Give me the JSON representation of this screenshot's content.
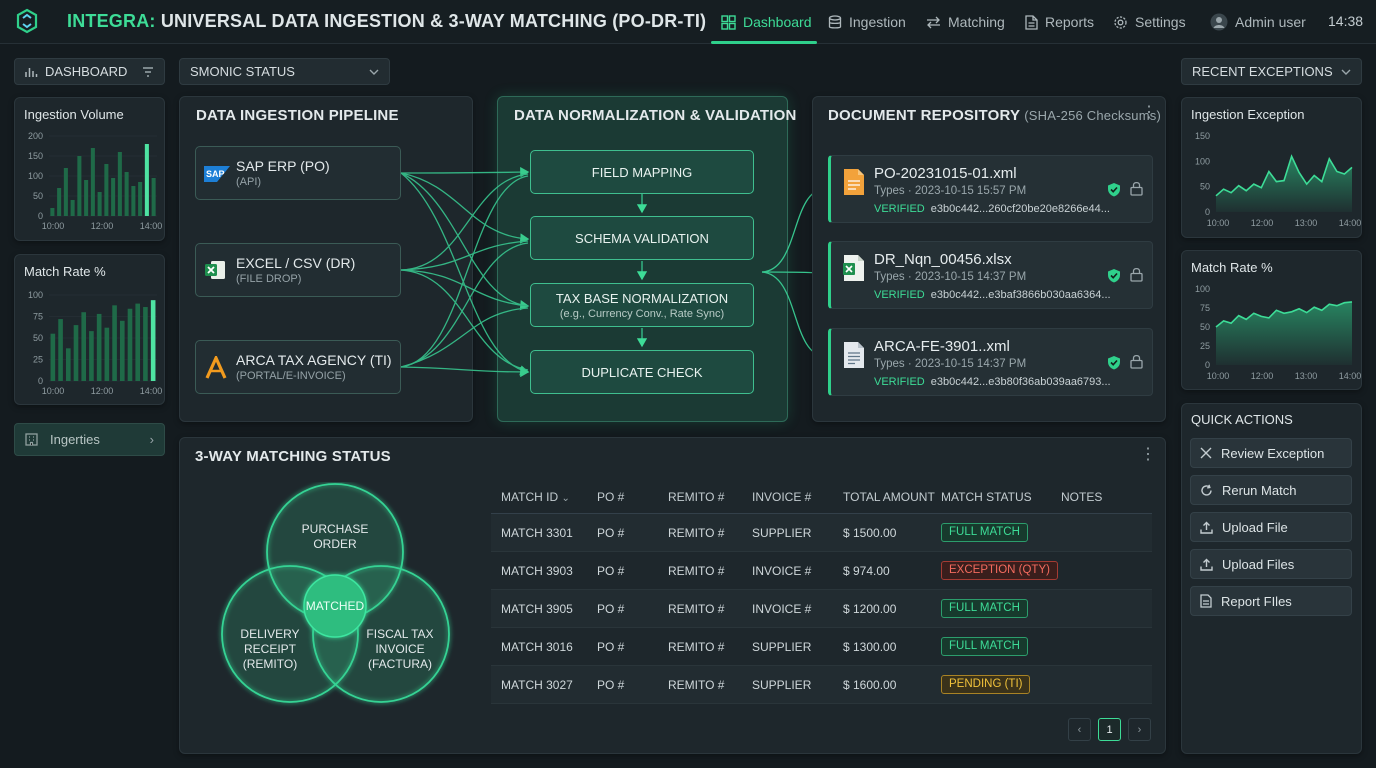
{
  "header": {
    "brand": "INTEGRA:",
    "title": "UNIVERSAL DATA INGESTION & 3-WAY MATCHING (PO-DR-TI)",
    "nav": [
      {
        "label": "Dashboard",
        "icon": "grid-icon",
        "active": true
      },
      {
        "label": "Ingestion",
        "icon": "database-icon"
      },
      {
        "label": "Matching",
        "icon": "swap-arrows-icon"
      },
      {
        "label": "Reports",
        "icon": "document-icon"
      },
      {
        "label": "Settings",
        "icon": "gear-icon"
      }
    ],
    "user": "Admin user",
    "clock": "14:38"
  },
  "sidebar": {
    "dashboard_label": "DASHBOARD",
    "status_select": "SMONIC STATUS",
    "nav_item": "Ingerties",
    "colors": {
      "accent": "#3ddc97",
      "bar": "#1f6a48"
    }
  },
  "left_charts": [
    {
      "title": "Ingestion Volume",
      "y_ticks": [
        "200",
        "150",
        "100",
        "50",
        "0"
      ],
      "x_ticks": [
        "10:00",
        "12:00",
        "14:00"
      ]
    },
    {
      "title": "Match Rate %",
      "y_ticks": [
        "100",
        "75",
        "50",
        "25",
        "0"
      ],
      "x_ticks": [
        "10:00",
        "12:00",
        "14:00"
      ]
    }
  ],
  "chart_data": [
    {
      "type": "bar",
      "title": "Ingestion Volume",
      "ylim": [
        0,
        200
      ],
      "values": [
        20,
        70,
        120,
        40,
        150,
        90,
        170,
        60,
        130,
        95,
        160,
        110,
        75,
        85,
        180,
        95
      ],
      "highlight_index": 14
    },
    {
      "type": "bar",
      "title": "Match Rate %",
      "ylim": [
        0,
        100
      ],
      "values": [
        55,
        72,
        38,
        65,
        80,
        58,
        78,
        62,
        88,
        70,
        84,
        90,
        86,
        94
      ],
      "highlight_index": 13
    },
    {
      "type": "area",
      "title": "Ingestion Exception",
      "ylim": [
        0,
        150
      ],
      "x_ticks": [
        "10:00",
        "12:00",
        "13:00",
        "14:00"
      ],
      "y_ticks": [
        "150",
        "100",
        "50",
        "0"
      ],
      "values": [
        32,
        45,
        38,
        52,
        42,
        55,
        48,
        80,
        60,
        62,
        110,
        78,
        55,
        72,
        60,
        105,
        80,
        75,
        88
      ]
    },
    {
      "type": "area",
      "title": "Match Rate %",
      "ylim": [
        0,
        100
      ],
      "x_ticks": [
        "10:00",
        "12:00",
        "13:00",
        "14:00"
      ],
      "y_ticks": [
        "100",
        "75",
        "50",
        "25",
        "0"
      ],
      "values": [
        50,
        58,
        55,
        65,
        60,
        68,
        64,
        62,
        72,
        68,
        70,
        74,
        69,
        76,
        72,
        80,
        78,
        82,
        83
      ]
    }
  ],
  "pipeline": {
    "title": "DATA INGESTION PIPELINE",
    "sources": [
      {
        "name": "SAP ERP (PO)",
        "sub": "(API)",
        "icon": "sap-logo-icon"
      },
      {
        "name": "EXCEL / CSV (DR)",
        "sub": "(FILE DROP)",
        "icon": "excel-icon"
      },
      {
        "name": "ARCA TAX AGENCY (TI)",
        "sub": "(PORTAL/E-INVOICE)",
        "icon": "arca-logo-icon"
      }
    ]
  },
  "normalization": {
    "title": "DATA NORMALIZATION & VALIDATION",
    "steps": [
      {
        "label": "FIELD MAPPING",
        "sub": ""
      },
      {
        "label": "SCHEMA VALIDATION",
        "sub": ""
      },
      {
        "label": "TAX BASE NORMALIZATION",
        "sub": "(e.g., Currency Conv., Rate Sync)"
      },
      {
        "label": "DUPLICATE CHECK",
        "sub": ""
      }
    ]
  },
  "repository": {
    "title": "DOCUMENT REPOSITORY",
    "subtitle": "(SHA-256 Checksums)",
    "docs": [
      {
        "name": "PO-20231015-01.xml",
        "meta": "Types · 2023-10-15 15:57 PM",
        "status": "VERIFIED",
        "hash": "e3b0c442...260cf20be20e8266e44...",
        "icon": "xml-file-icon"
      },
      {
        "name": "DR_Nqn_00456.xlsx",
        "meta": "Types · 2023-10-15 14:37 PM",
        "status": "VERIFIED",
        "hash": "e3b0c442...e3baf3866b030aa6364...",
        "icon": "xlsx-file-icon"
      },
      {
        "name": "ARCA-FE-3901..xml",
        "meta": "Types · 2023-10-15 14:37 PM",
        "status": "VERIFIED",
        "hash": "e3b0c442...e3b80f36ab039aa6793...",
        "icon": "invoice-file-icon"
      }
    ]
  },
  "exceptions": {
    "select": "RECENT EXCEPTIONS",
    "chart1_title": "Ingestion Exception",
    "chart2_title": "Match Rate %"
  },
  "matching": {
    "title": "3-WAY MATCHING STATUS",
    "venn": {
      "po": [
        "PURCHASE",
        "ORDER"
      ],
      "dr": [
        "DELIVERY",
        "RECEIPT",
        "(REMITO)"
      ],
      "ti": [
        "FISCAL TAX",
        "INVOICE",
        "(FACTURA)"
      ],
      "center": "MATCHED"
    },
    "columns": [
      "MATCH ID",
      "PO #",
      "REMITO #",
      "INVOICE #",
      "TOTAL AMOUNT",
      "MATCH STATUS",
      "NOTES"
    ],
    "rows": [
      {
        "id": "MATCH 3301",
        "po": "PO #",
        "remito": "REMITO #",
        "invoice": "SUPPLIER",
        "amount": "$ 1500.00",
        "status": "FULL MATCH",
        "kind": "full"
      },
      {
        "id": "MATCH 3903",
        "po": "PO #",
        "remito": "REMITO #",
        "invoice": "INVOICE #",
        "amount": "$ 974.00",
        "status": "EXCEPTION (QTY)",
        "kind": "exc"
      },
      {
        "id": "MATCH 3905",
        "po": "PO #",
        "remito": "REMITO #",
        "invoice": "INVOICE #",
        "amount": "$ 1200.00",
        "status": "FULL MATCH",
        "kind": "full"
      },
      {
        "id": "MATCH 3016",
        "po": "PO #",
        "remito": "REMITO #",
        "invoice": "SUPPLIER",
        "amount": "$ 1300.00",
        "status": "FULL MATCH",
        "kind": "full"
      },
      {
        "id": "MATCH 3027",
        "po": "PO #",
        "remito": "REMITO #",
        "invoice": "SUPPLIER",
        "amount": "$ 1600.00",
        "status": "PENDING (TI)",
        "kind": "pend"
      }
    ],
    "pagination": {
      "prev": "‹",
      "page": "1",
      "next": "›"
    }
  },
  "quick_actions": {
    "title": "QUICK ACTIONS",
    "items": [
      {
        "label": "Review Exception",
        "icon": "close-icon"
      },
      {
        "label": "Rerun Match",
        "icon": "refresh-icon"
      },
      {
        "label": "Upload File",
        "icon": "upload-icon"
      },
      {
        "label": "Upload Files",
        "icon": "upload-icon"
      },
      {
        "label": "Report FIles",
        "icon": "report-icon"
      }
    ]
  }
}
